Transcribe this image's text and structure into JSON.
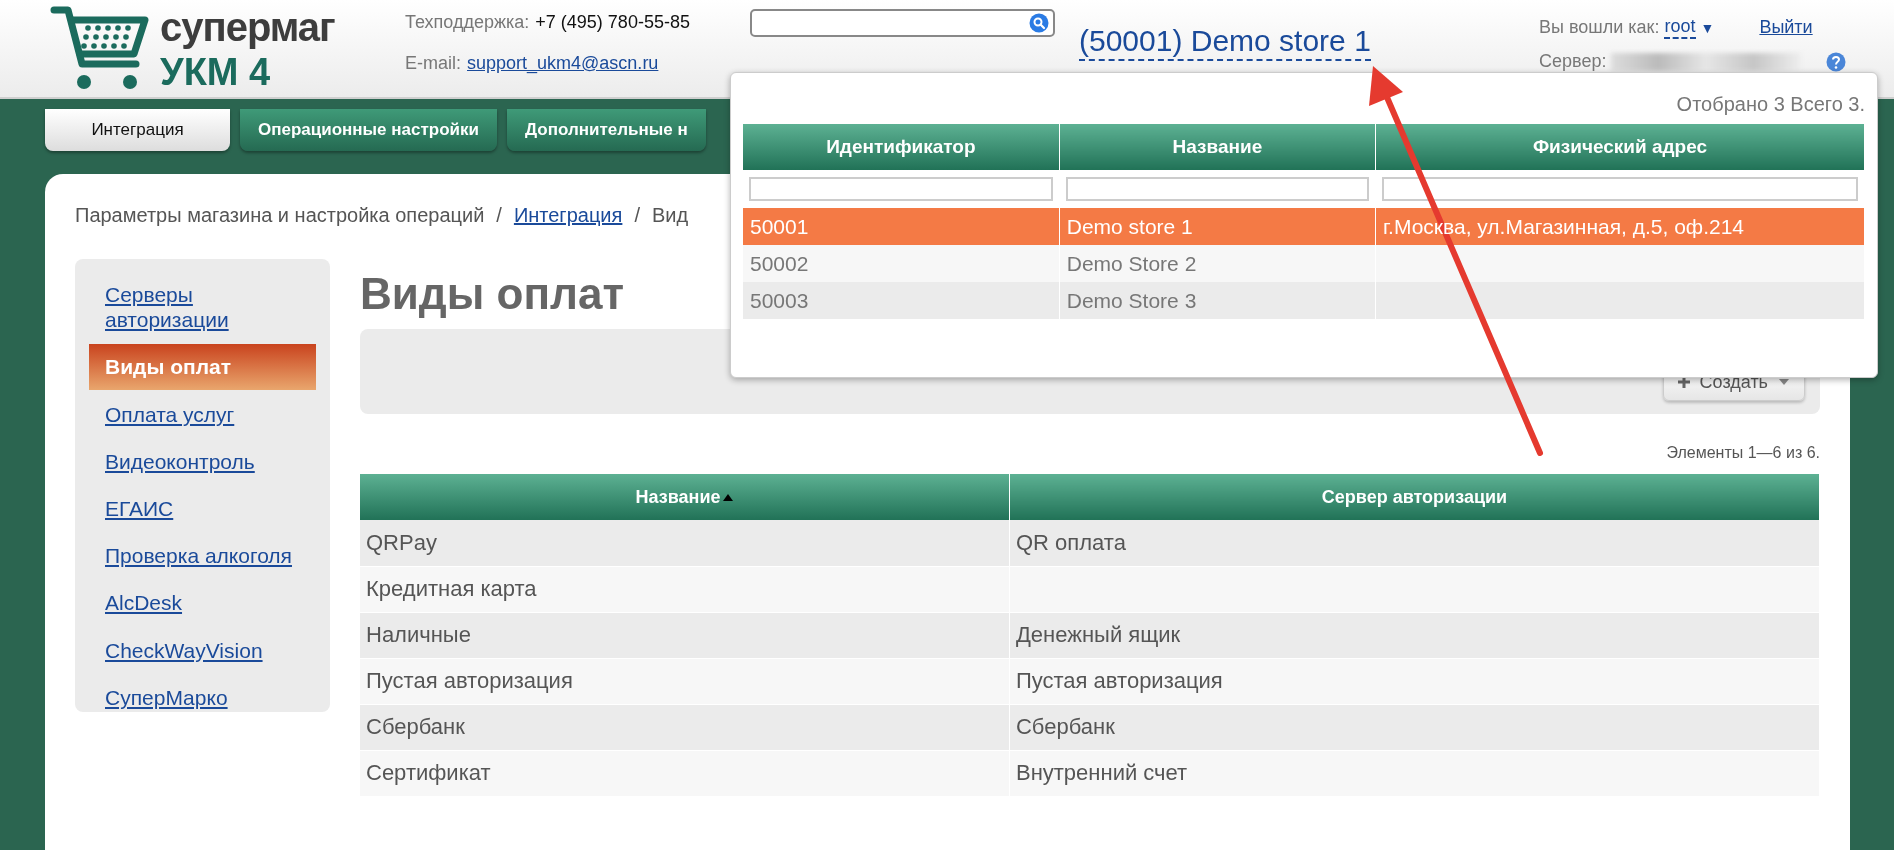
{
  "header": {
    "logo": {
      "line1": "супермаг",
      "line2": "УКМ 4"
    },
    "support_label": "Техподдержка:",
    "support_phone": "+7 (495) 780-55-85",
    "email_label": "E-mail:",
    "email": "support_ukm4@ascn.ru",
    "store": "(50001) Demo store 1",
    "user_label": "Вы вошли как:",
    "user": "root",
    "user_caret": "▼",
    "logout": "Выйти",
    "server_label": "Сервер:"
  },
  "tabs": [
    {
      "label": "Интеграция",
      "selected": true
    },
    {
      "label": "Операционные настройки",
      "selected": false
    },
    {
      "label": "Дополнительные н",
      "selected": false
    }
  ],
  "breadcrumb": {
    "separator": "/",
    "items": [
      {
        "label": "Параметры магазина и настройка операций",
        "link": false
      },
      {
        "label": "Интеграция",
        "link": true
      },
      {
        "label": "Вид",
        "link": false
      }
    ]
  },
  "sidebar": {
    "items": [
      {
        "label": "Серверы авторизации",
        "selected": false
      },
      {
        "label": "Виды оплат",
        "selected": true
      },
      {
        "label": "Оплата услуг",
        "selected": false
      },
      {
        "label": "Видеоконтроль",
        "selected": false
      },
      {
        "label": "ЕГАИС",
        "selected": false
      },
      {
        "label": "Проверка алкоголя",
        "selected": false
      },
      {
        "label": "AlcDesk",
        "selected": false
      },
      {
        "label": "CheckWayVision",
        "selected": false
      },
      {
        "label": "СуперМарко",
        "selected": false
      }
    ]
  },
  "page_title": "Виды оплат",
  "create_button": {
    "label": "Создать"
  },
  "pagination": "Элементы 1—6 из 6.",
  "table": {
    "columns": [
      {
        "label": "Название",
        "sorted": true
      },
      {
        "label": "Сервер авторизации",
        "sorted": false
      }
    ],
    "rows": [
      {
        "cells": [
          "QRPay",
          "QR оплата"
        ]
      },
      {
        "cells": [
          "Кредитная карта"
        ]
      },
      {
        "cells": [
          "Наличные",
          "Денежный ящик"
        ]
      },
      {
        "cells": [
          "Пустая авторизация",
          "Пустая авторизация"
        ]
      },
      {
        "cells": [
          "Сбербанк",
          "Сбербанк"
        ]
      },
      {
        "cells": [
          "Сертификат",
          "Внутренний счет"
        ]
      }
    ]
  },
  "store_popup": {
    "summary": "Отобрано 3 Всего 3.",
    "columns": [
      {
        "label": "Идентификатор"
      },
      {
        "label": "Название"
      },
      {
        "label": "Физический адрес"
      }
    ],
    "rows": [
      {
        "cells": [
          "50001",
          "Demo store 1",
          "г.Москва, ул.Магазинная, д.5, оф.214"
        ],
        "selected": true
      },
      {
        "cells": [
          "50002",
          "Demo Store 2"
        ],
        "selected": false
      },
      {
        "cells": [
          "50003",
          "Demo Store 3"
        ],
        "selected": false
      }
    ]
  }
}
